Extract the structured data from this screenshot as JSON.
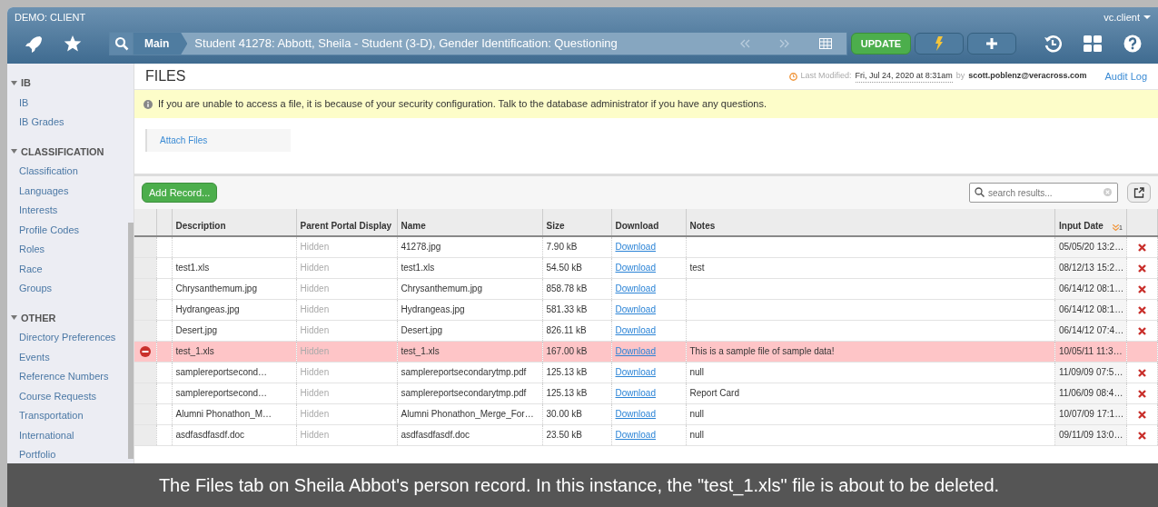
{
  "window": {
    "title": "DEMO: CLIENT",
    "user": "vc.client"
  },
  "breadcrumb": {
    "section": "Main",
    "record": "Student 41278: Abbott, Sheila - Student (3-D), Gender Identification: Questioning"
  },
  "toolbar": {
    "update": "UPDATE"
  },
  "sidebar": [
    {
      "label": "IB",
      "expanded": true,
      "children": [
        {
          "label": "IB"
        },
        {
          "label": "IB Grades"
        }
      ]
    },
    {
      "label": "CLASSIFICATION",
      "expanded": true,
      "children": [
        {
          "label": "Classification"
        },
        {
          "label": "Languages"
        },
        {
          "label": "Interests"
        },
        {
          "label": "Profile Codes"
        },
        {
          "label": "Roles"
        },
        {
          "label": "Race"
        },
        {
          "label": "Groups"
        }
      ]
    },
    {
      "label": "OTHER",
      "expanded": true,
      "children": [
        {
          "label": "Directory Preferences"
        },
        {
          "label": "Events"
        },
        {
          "label": "Reference Numbers"
        },
        {
          "label": "Course Requests"
        },
        {
          "label": "Transportation"
        },
        {
          "label": "International"
        },
        {
          "label": "Portfolio"
        }
      ]
    }
  ],
  "page": {
    "title": "FILES",
    "modified_label": "Last Modified:",
    "modified_date": "Fri, Jul 24, 2020 at 8:31am",
    "by": "by",
    "modified_by": "scott.poblenz@veracross.com",
    "audit_log": "Audit Log"
  },
  "alert": "If you are unable to access a file, it is because of your security configuration. Talk to the database administrator if you have any questions.",
  "attach": "Attach Files",
  "add_record": "Add Record...",
  "search": {
    "placeholder": "search results..."
  },
  "table": {
    "columns": [
      "Description",
      "Parent Portal Display",
      "Name",
      "Size",
      "Download",
      "Notes",
      "Input Date"
    ],
    "sort_order": "1",
    "rows": [
      {
        "description": "",
        "portal": "Hidden",
        "name": "41278.jpg",
        "size": "7.90 kB",
        "download": "Download",
        "notes": "",
        "date": "05/05/20 13:2…",
        "deleting": false
      },
      {
        "description": "test1.xls",
        "portal": "Hidden",
        "name": "test1.xls",
        "size": "54.50 kB",
        "download": "Download",
        "notes": "test",
        "date": "08/12/13 15:2…",
        "deleting": false
      },
      {
        "description": "Chrysanthemum.jpg",
        "portal": "Hidden",
        "name": "Chrysanthemum.jpg",
        "size": "858.78 kB",
        "download": "Download",
        "notes": "",
        "date": "06/14/12 08:1…",
        "deleting": false
      },
      {
        "description": "Hydrangeas.jpg",
        "portal": "Hidden",
        "name": "Hydrangeas.jpg",
        "size": "581.33 kB",
        "download": "Download",
        "notes": "",
        "date": "06/14/12 08:1…",
        "deleting": false
      },
      {
        "description": "Desert.jpg",
        "portal": "Hidden",
        "name": "Desert.jpg",
        "size": "826.11 kB",
        "download": "Download",
        "notes": "",
        "date": "06/14/12 07:4…",
        "deleting": false
      },
      {
        "description": "test_1.xls",
        "portal": "Hidden",
        "name": "test_1.xls",
        "size": "167.00 kB",
        "download": "Download",
        "notes": "This is a sample file of sample data!",
        "date": "10/05/11 11:3…",
        "deleting": true
      },
      {
        "description": "samplereportsecond…",
        "portal": "Hidden",
        "name": "samplereportsecondarytmp.pdf",
        "size": "125.13 kB",
        "download": "Download",
        "notes": "null",
        "date": "11/09/09 07:5…",
        "deleting": false
      },
      {
        "description": "samplereportsecond…",
        "portal": "Hidden",
        "name": "samplereportsecondarytmp.pdf",
        "size": "125.13 kB",
        "download": "Download",
        "notes": "Report Card",
        "date": "11/06/09 08:4…",
        "deleting": false
      },
      {
        "description": "Alumni Phonathon_M…",
        "portal": "Hidden",
        "name": "Alumni Phonathon_Merge_For…",
        "size": "30.00 kB",
        "download": "Download",
        "notes": "null",
        "date": "10/07/09 17:1…",
        "deleting": false
      },
      {
        "description": "asdfasdfasdf.doc",
        "portal": "Hidden",
        "name": "asdfasdfasdf.doc",
        "size": "23.50 kB",
        "download": "Download",
        "notes": "null",
        "date": "09/11/09 13:0…",
        "deleting": false
      }
    ]
  },
  "caption": "The Files tab on Sheila Abbot's person record. In this instance, the \"test_1.xls\" file is about to be deleted."
}
